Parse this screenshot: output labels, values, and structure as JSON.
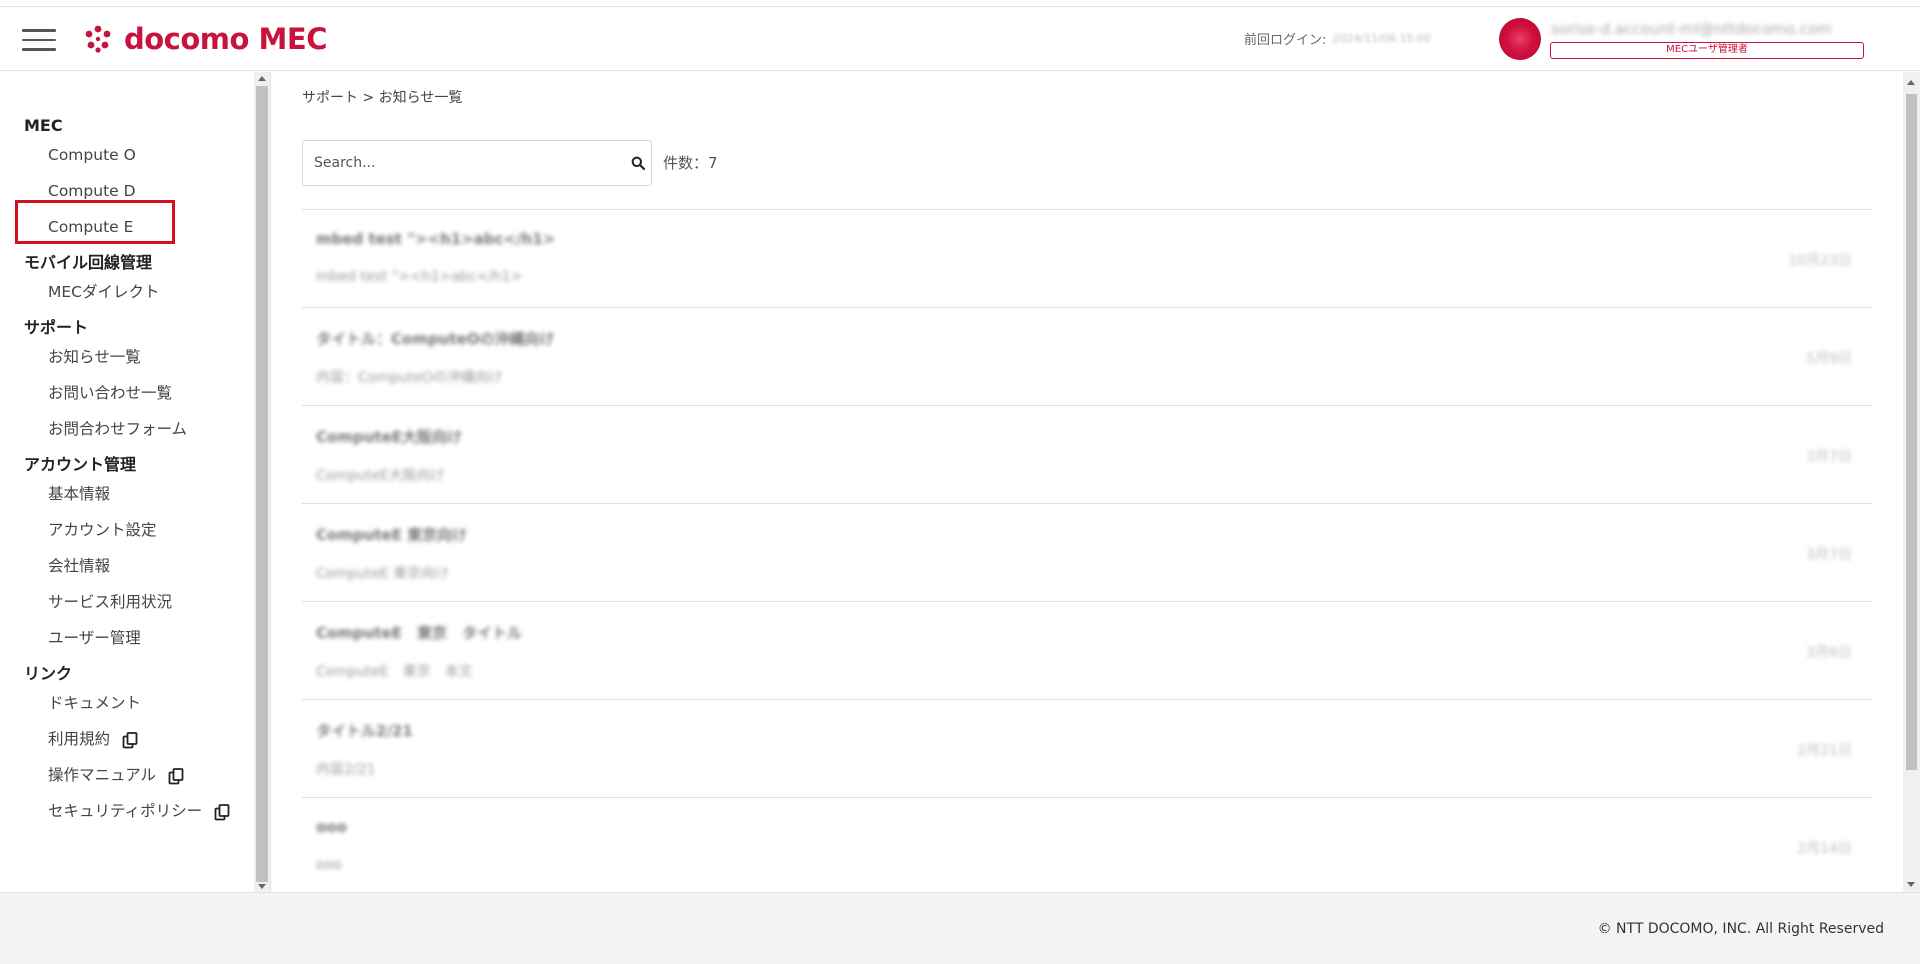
{
  "header": {
    "logo_text": "docomo MEC",
    "last_login_label": "前回ログイン:",
    "last_login_value": "2024/11/06 15:00",
    "user_email": "sorise-d.account-ml@nttdocomo.com",
    "user_role": "MECユーザ管理者",
    "brand_color": "#c8143c"
  },
  "sidebar": {
    "groups": [
      {
        "label": "MEC",
        "items": [
          {
            "label": "Compute O"
          },
          {
            "label": "Compute D"
          },
          {
            "label": "Compute E"
          }
        ]
      },
      {
        "label": "モバイル回線管理",
        "items": [
          {
            "label": "MECダイレクト"
          }
        ]
      },
      {
        "label": "サポート",
        "items": [
          {
            "label": "お知らせ一覧"
          },
          {
            "label": "お問い合わせ一覧"
          },
          {
            "label": "お問合わせフォーム"
          }
        ]
      },
      {
        "label": "アカウント管理",
        "items": [
          {
            "label": "基本情報"
          },
          {
            "label": "アカウント設定"
          },
          {
            "label": "会社情報"
          },
          {
            "label": "サービス利用状況"
          },
          {
            "label": "ユーザー管理"
          }
        ]
      },
      {
        "label": "リンク",
        "items": [
          {
            "label": "ドキュメント"
          },
          {
            "label": "利用規約",
            "icon": "copy-icon"
          },
          {
            "label": "操作マニュアル",
            "icon": "copy-icon"
          },
          {
            "label": "セキュリティポリシー",
            "icon": "copy-icon"
          }
        ]
      }
    ]
  },
  "main": {
    "breadcrumb": "サポート > お知らせ一覧",
    "search_placeholder": "Search...",
    "count_text": "件数：7",
    "notices": [
      {
        "title": "mbed test \"><h1>abc</h1>",
        "body": "mbed test \"><h1>abc</h1>",
        "date": "10月23日"
      },
      {
        "title": "タイトル：ComputeOの沖縄向け",
        "body": "内容：ComputeOの沖縄向け",
        "date": "5月9日"
      },
      {
        "title": "ComputeE大阪向け",
        "body": "ComputeE大阪向け",
        "date": "3月7日"
      },
      {
        "title": "ComputeE 東京向け",
        "body": "ComputeE 東京向け",
        "date": "3月7日"
      },
      {
        "title": "ComputeE　東京　タイトル",
        "body": "ComputeE　東京　本文",
        "date": "3月6日"
      },
      {
        "title": "タイトル2/21",
        "body": "内容2/21",
        "date": "2月21日"
      },
      {
        "title": "ooo",
        "body": "ooo",
        "date": "2月14日"
      }
    ]
  },
  "footer": {
    "copyright": "© NTT DOCOMO, INC. All Right Reserved"
  }
}
